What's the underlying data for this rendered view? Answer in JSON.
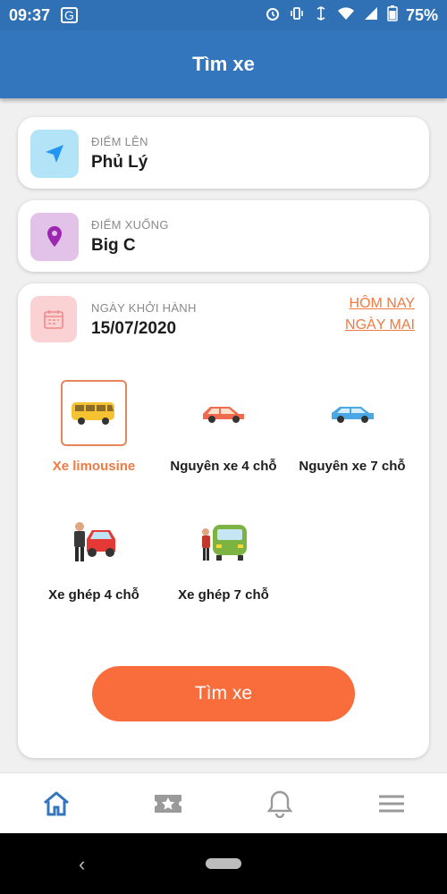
{
  "status_bar": {
    "time": "09:37",
    "battery": "75%",
    "icons": [
      "translate-icon",
      "alarm-icon",
      "vibrate-icon",
      "data-saver-icon",
      "wifi-icon",
      "signal-icon",
      "battery-icon"
    ]
  },
  "header": {
    "title": "Tìm xe"
  },
  "pickup": {
    "label": "ĐIỂM LÊN",
    "value": "Phủ Lý",
    "icon": "navigation-arrow-icon",
    "icon_bg": "#b3e3f7",
    "icon_color": "#2196f3"
  },
  "dropoff": {
    "label": "ĐIỂM XUỐNG",
    "value": "Big C",
    "icon": "map-pin-icon",
    "icon_bg": "#e2c2e8",
    "icon_color": "#9c27b0"
  },
  "departure": {
    "label": "NGÀY KHỞI HÀNH",
    "value": "15/07/2020",
    "icon": "calendar-icon",
    "today": "HÔM NAY",
    "tomorrow": "NGÀY MAI"
  },
  "vehicles": [
    {
      "label": "Xe limousine",
      "icon": "limousine-van-icon",
      "selected": true
    },
    {
      "label": "Nguyên xe 4 chỗ",
      "icon": "red-car-icon",
      "selected": false
    },
    {
      "label": "Nguyên xe 7 chỗ",
      "icon": "blue-car-icon",
      "selected": false
    },
    {
      "label": "Xe ghép 4 chỗ",
      "icon": "shared-car-4-icon",
      "selected": false
    },
    {
      "label": "Xe ghép 7 chỗ",
      "icon": "shared-van-7-icon",
      "selected": false
    }
  ],
  "search_button": {
    "label": "Tìm xe"
  },
  "bottom_nav": [
    "home-icon",
    "ticket-icon",
    "bell-icon",
    "menu-icon"
  ],
  "colors": {
    "primary": "#3476bd",
    "accent": "#f96c3c",
    "link": "#f07a43"
  }
}
